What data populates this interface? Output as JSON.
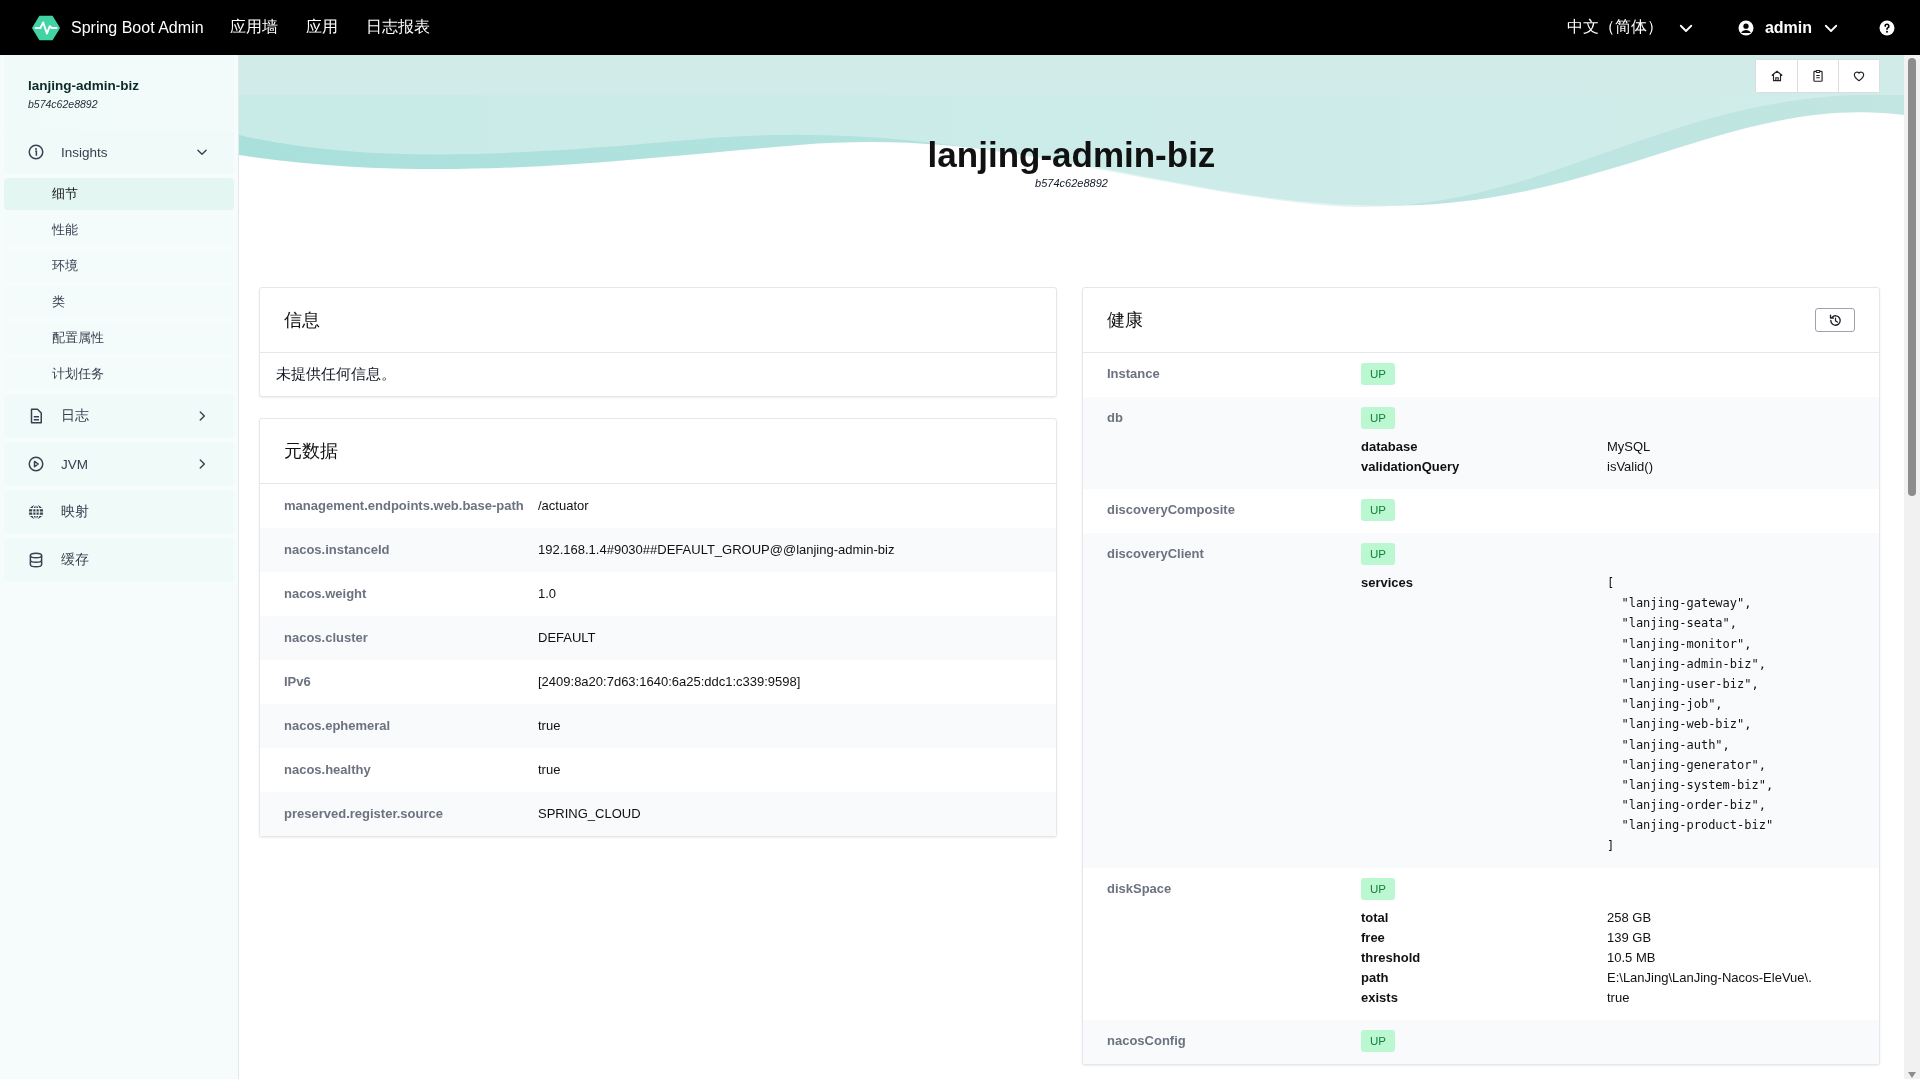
{
  "navbar": {
    "brand": "Spring Boot Admin",
    "links": [
      "应用墙",
      "应用",
      "日志报表"
    ],
    "language": "中文（简体）",
    "user": "admin"
  },
  "sidebar": {
    "app_name": "lanjing-admin-biz",
    "instance_id": "b574c62e8892",
    "items": [
      {
        "label": "Insights",
        "expanded": true,
        "children": [
          {
            "label": "细节",
            "selected": true
          },
          {
            "label": "性能",
            "selected": false
          },
          {
            "label": "环境",
            "selected": false
          },
          {
            "label": "类",
            "selected": false
          },
          {
            "label": "配置属性",
            "selected": false
          },
          {
            "label": "计划任务",
            "selected": false
          }
        ]
      },
      {
        "label": "日志",
        "expanded": false
      },
      {
        "label": "JVM",
        "expanded": false
      },
      {
        "label": "映射"
      },
      {
        "label": "缓存"
      }
    ]
  },
  "header": {
    "title": "lanjing-admin-biz",
    "instance_id": "b574c62e8892"
  },
  "info": {
    "title": "信息",
    "message": "未提供任何信息。"
  },
  "metadata": {
    "title": "元数据",
    "rows": [
      {
        "key": "management.endpoints.web.base-path",
        "value": "/actuator"
      },
      {
        "key": "nacos.instanceId",
        "value": "192.168.1.4#9030##DEFAULT_GROUP@@lanjing-admin-biz"
      },
      {
        "key": "nacos.weight",
        "value": "1.0"
      },
      {
        "key": "nacos.cluster",
        "value": "DEFAULT"
      },
      {
        "key": "IPv6",
        "value": "[2409:8a20:7d63:1640:6a25:ddc1:c339:9598]"
      },
      {
        "key": "nacos.ephemeral",
        "value": "true"
      },
      {
        "key": "nacos.healthy",
        "value": "true"
      },
      {
        "key": "preserved.register.source",
        "value": "SPRING_CLOUD"
      }
    ]
  },
  "health": {
    "title": "健康",
    "components": [
      {
        "name": "Instance",
        "status": "UP"
      },
      {
        "name": "db",
        "status": "UP",
        "details": [
          {
            "key": "database",
            "value": "MySQL",
            "kind": "text"
          },
          {
            "key": "validationQuery",
            "value": "isValid()",
            "kind": "text"
          }
        ]
      },
      {
        "name": "discoveryComposite",
        "status": "UP"
      },
      {
        "name": "discoveryClient",
        "status": "UP",
        "details": [
          {
            "key": "services",
            "kind": "json",
            "value": "[\n  \"lanjing-gateway\",\n  \"lanjing-seata\",\n  \"lanjing-monitor\",\n  \"lanjing-admin-biz\",\n  \"lanjing-user-biz\",\n  \"lanjing-job\",\n  \"lanjing-web-biz\",\n  \"lanjing-auth\",\n  \"lanjing-generator\",\n  \"lanjing-system-biz\",\n  \"lanjing-order-biz\",\n  \"lanjing-product-biz\"\n]"
          }
        ]
      },
      {
        "name": "diskSpace",
        "status": "UP",
        "details": [
          {
            "key": "total",
            "value": "258 GB",
            "kind": "text"
          },
          {
            "key": "free",
            "value": "139 GB",
            "kind": "text"
          },
          {
            "key": "threshold",
            "value": "10.5 MB",
            "kind": "text"
          },
          {
            "key": "path",
            "value": "E:\\LanJing\\LanJing-Nacos-EleVue\\.",
            "kind": "text"
          },
          {
            "key": "exists",
            "value": "true",
            "kind": "text"
          }
        ]
      },
      {
        "name": "nacosConfig",
        "status": "UP"
      }
    ]
  }
}
